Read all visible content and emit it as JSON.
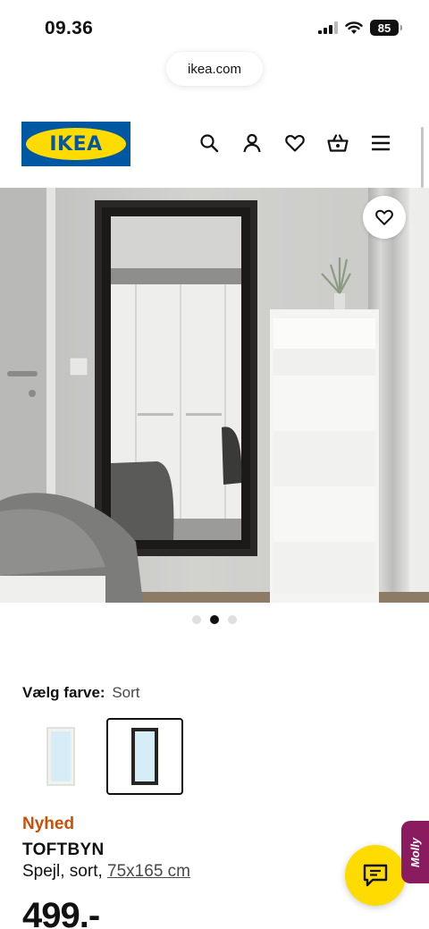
{
  "status_bar": {
    "time": "09.36",
    "battery": "85",
    "icons": [
      "signal-icon",
      "wifi-icon",
      "battery-icon"
    ]
  },
  "browser": {
    "url": "ikea.com"
  },
  "header": {
    "logo_text": "IKEA",
    "icons": [
      "search-icon",
      "profile-icon",
      "heart-icon",
      "basket-icon",
      "menu-icon"
    ]
  },
  "gallery": {
    "image_count": 3,
    "active_index": 1,
    "favorite_icon": "heart-icon"
  },
  "color_selector": {
    "label": "Vælg farve:",
    "value": "Sort",
    "options": [
      "white-mirror",
      "black-mirror"
    ],
    "selected_index": 1
  },
  "product": {
    "badge": "Nyhed",
    "name": "TOFTBYN",
    "description": "Spejl, sort,",
    "size": "75x165 cm",
    "price": "499.-"
  },
  "chat": {
    "icon": "chat-icon",
    "molly_label": "Molly"
  },
  "colors": {
    "ikea_blue": "#0058a3",
    "ikea_yellow": "#ffdb00",
    "badge_orange": "#ca5008",
    "molly_purple": "#8a1b5e"
  }
}
